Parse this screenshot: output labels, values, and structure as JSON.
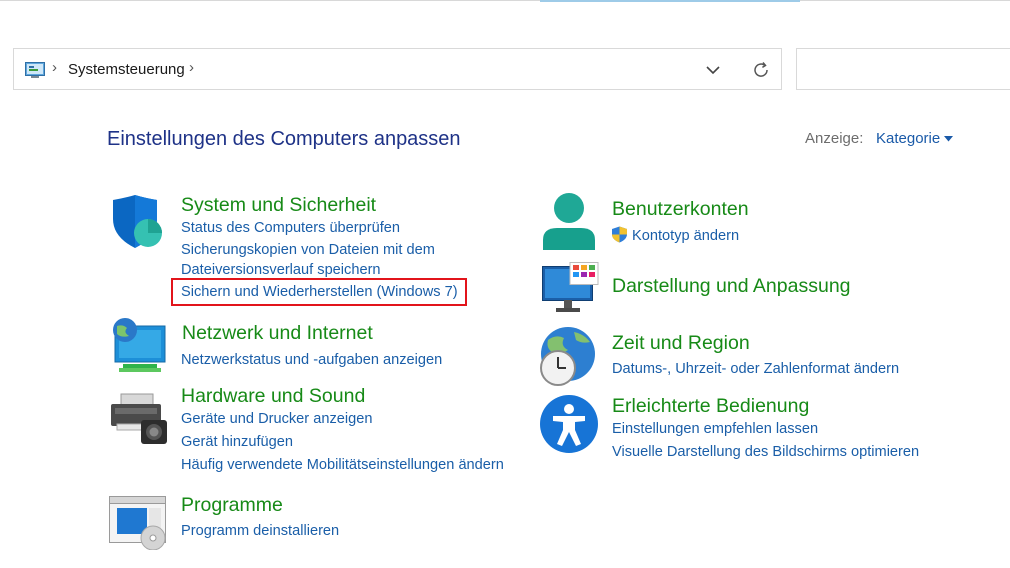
{
  "address_bar": {
    "location": "Systemsteuerung",
    "separator": "›"
  },
  "search": {
    "placeholder": ""
  },
  "page": {
    "title": "Einstellungen des Computers anpassen",
    "view_label": "Anzeige:",
    "view_value": "Kategorie"
  },
  "categories": [
    {
      "title": "System und Sicherheit",
      "links": [
        "Status des Computers überprüfen",
        "Sicherungskopien von Dateien mit dem",
        "Dateiversionsverlauf speichern",
        "Sichern und Wiederherstellen (Windows 7)"
      ]
    },
    {
      "title": "Netzwerk und Internet",
      "links": [
        "Netzwerkstatus und -aufgaben anzeigen"
      ]
    },
    {
      "title": "Hardware und Sound",
      "links": [
        "Geräte und Drucker anzeigen",
        "Gerät hinzufügen",
        "Häufig verwendete Mobilitätseinstellungen ändern"
      ]
    },
    {
      "title": "Programme",
      "links": [
        "Programm deinstallieren"
      ]
    },
    {
      "title": "Benutzerkonten",
      "links": [
        "Kontotyp ändern"
      ]
    },
    {
      "title": "Darstellung und Anpassung",
      "links": []
    },
    {
      "title": "Zeit und Region",
      "links": [
        "Datums-, Uhrzeit- oder Zahlenformat ändern"
      ]
    },
    {
      "title": "Erleichterte Bedienung",
      "links": [
        "Einstellungen empfehlen lassen",
        "Visuelle Darstellung des Bildschirms optimieren"
      ]
    }
  ],
  "colors": {
    "title_blue": "#1e3287",
    "category_green": "#178a17",
    "link_blue": "#1a5ea8",
    "highlight_red": "#e2141b"
  }
}
